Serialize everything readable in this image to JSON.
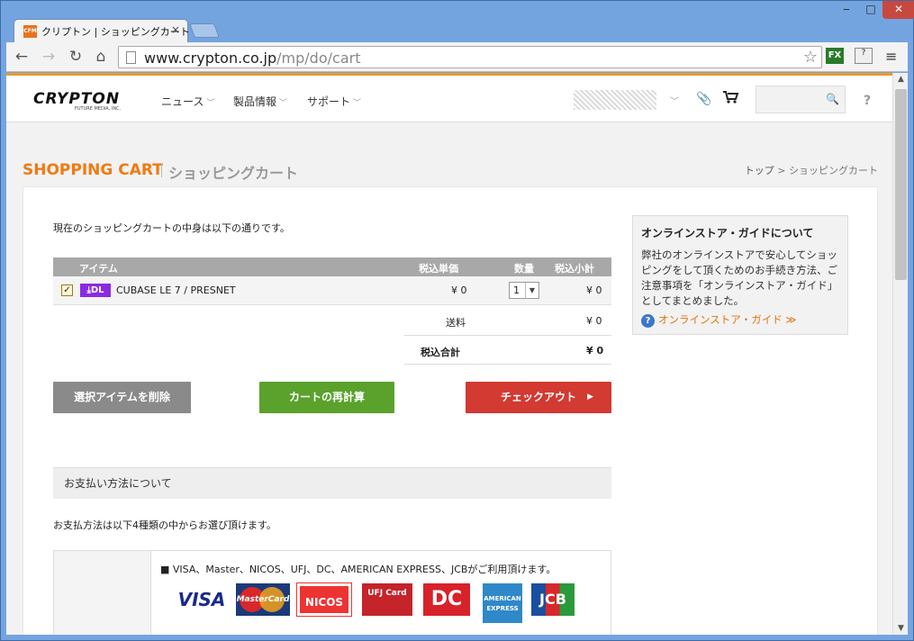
{
  "browser": {
    "tab_title": "クリプトン | ショッピングカート",
    "tab_favicon": "CFM",
    "tab_close": "×",
    "window_min": "‒",
    "window_max": "□",
    "window_close": "✕",
    "url_host": "www.crypton.co.jp",
    "url_path": "/mp/do/cart",
    "ext_fx": "FX",
    "ext_2": "?",
    "icons": [
      "back-icon",
      "forward-icon",
      "reload-icon",
      "home-icon",
      "page-icon",
      "star-icon",
      "menu-icon"
    ]
  },
  "site": {
    "logo": "CRYPTON",
    "logo_sub": "FUTURE MEDIA, INC.",
    "nav": [
      "ニュース",
      "製品情報",
      "サポート"
    ],
    "accent": "#f07a12"
  },
  "page": {
    "title": "SHOPPING CART",
    "subtitle": "ショッピングカート",
    "breadcrumb": {
      "home": "トップ",
      "sep": ">",
      "current": "ショッピングカート"
    },
    "intro": "現在のショッピングカートの中身は以下の通りです。"
  },
  "cart": {
    "headers": {
      "item": "アイテム",
      "unit_price": "税込単価",
      "qty": "数量",
      "subtotal": "税込小計"
    },
    "items": [
      {
        "checked": true,
        "badge": "DL",
        "name": "CUBASE LE 7 / PRESNET",
        "unit_price": "¥ 0",
        "qty": "1",
        "subtotal": "¥ 0"
      }
    ],
    "shipping_label": "送料",
    "shipping_value": "¥ 0",
    "total_label": "税込合計",
    "total_value": "¥ 0",
    "buttons": {
      "delete": "選択アイテムを削除",
      "recalc": "カートの再計算",
      "checkout": "チェックアウト"
    }
  },
  "payment": {
    "heading": "お支払い方法について",
    "description": "お支払方法は以下4種類の中からお選び頂けます。",
    "cards_text": "■ VISA、Master、NICOS、UFJ、DC、AMERICAN EXPRESS、JCBがご利用頂けます。",
    "cards": [
      "VISA",
      "MasterCard",
      "NICOS",
      "UFJ Card",
      "DC",
      "AMERICAN EXPRESS",
      "JCB"
    ]
  },
  "guide": {
    "title": "オンラインストア・ガイドについて",
    "text": "弊社のオンラインストアで安心してショッピングをして頂くためのお手続き方法、ご注意事項を「オンラインストア・ガイド」としてまとめました。",
    "link": "オンラインストア・ガイド ≫"
  }
}
